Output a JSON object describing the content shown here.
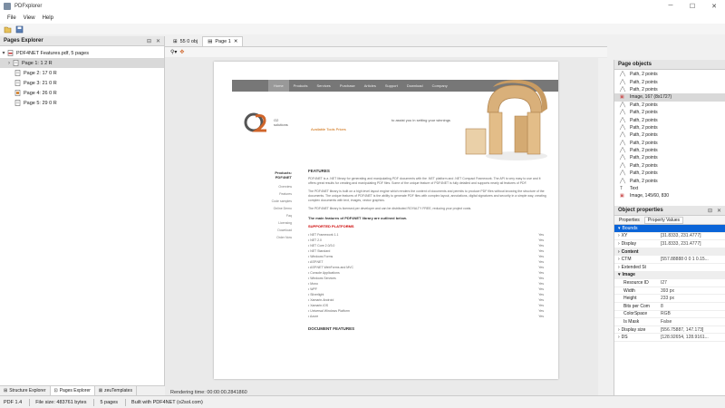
{
  "window": {
    "title": "PDFxplorer"
  },
  "menu": [
    "File",
    "View",
    "Help"
  ],
  "left_pane": {
    "header": "Pages Explorer",
    "tree": [
      {
        "label": "PDF4NET Features.pdf, 5 pages",
        "level": 0,
        "expanded": true,
        "icon": "pdf-file-icon"
      },
      {
        "label": "Page 1: 1 2 R",
        "level": 1,
        "selected": true,
        "icon": "page-icon"
      },
      {
        "label": "Page 2: 17 0 R",
        "level": 1,
        "icon": "page-icon"
      },
      {
        "label": "Page 3: 21 0 R",
        "level": 1,
        "icon": "page-icon"
      },
      {
        "label": "Page 4: 26 0 R",
        "level": 1,
        "icon": "page-icon"
      },
      {
        "label": "Page 5: 29 0 R",
        "level": 1,
        "icon": "page-icon"
      }
    ],
    "bottom_tabs": [
      "Structure Explorer",
      "Pages Explorer",
      "zeuTemplates"
    ]
  },
  "doc_tabs": [
    {
      "label": "55 0 obj",
      "active": false
    },
    {
      "label": "Page 1",
      "active": true
    }
  ],
  "render_info": "Rendering time: 00:00:00.2841860",
  "page": {
    "nav": [
      "Home",
      "Products",
      "Services",
      "Purchase",
      "Articles",
      "Support",
      "Download",
      "Company"
    ],
    "nav_active": 0,
    "logo_text": [
      "O2",
      "solutions"
    ],
    "slogan": "to assist you in setting your winnings",
    "sublink": "Available Tools Prices",
    "side_heading": [
      "Products:",
      "PDF4NET"
    ],
    "side_nav": [
      "Overview",
      "Features",
      "Code samples",
      "Online Demo",
      "Faq",
      "Licensing",
      "Download",
      "Order Now"
    ],
    "features_head": "FEATURES",
    "paragraphs": [
      "PDF4NET is a .NET library for generating and manipulating PDF documents with the .NET platform and .NET Compact Framework. The API is very easy to use and it offers great results for creating and manipulating PDF files. Some of the unique feature of PDF4NET is fully detailed and supports nearly all features of PDF.",
      "The PDF4NET library is built on a high level layout engine which renders the content of documents and permits to produce PDF files without knowing the structure of the documents. The unique features of PDF4NET is the ability to generate PDF files with complex layout, annotations, digital signatures and security in a simple way, creating complex documents with text, images, vector graphics.",
      "The PDF4NET library is licensed per developer and can be distributed ROYALTY FREE, reducing your project costs."
    ],
    "main_features_lead": "The main features of PDF4NET library are outlined below.",
    "supported_platforms_head": "SUPPORTED PLATFORMS",
    "platforms": [
      {
        "name": "• NET Framework 1.1",
        "value": "Yes"
      },
      {
        "name": "• NET 2.0",
        "value": "Yes"
      },
      {
        "name": "• NET Core 2.0/3.0",
        "value": "Yes"
      },
      {
        "name": "• NET Standard",
        "value": "Yes"
      },
      {
        "name": "• Windows Forms",
        "value": "Yes"
      },
      {
        "name": "• ASP.NET",
        "value": "Yes"
      },
      {
        "name": "• ASP.NET WebForms and MVC",
        "value": "Yes"
      },
      {
        "name": "• Console Applications",
        "value": "Yes"
      },
      {
        "name": "• Windows Services",
        "value": "Yes"
      },
      {
        "name": "• Mono",
        "value": "Yes"
      },
      {
        "name": "• WPF",
        "value": "Yes"
      },
      {
        "name": "• Silverlight",
        "value": "Yes"
      },
      {
        "name": "• Xamarin.Android",
        "value": "Yes"
      },
      {
        "name": "• Xamarin.iOS",
        "value": "Yes"
      },
      {
        "name": "• Universal Windows Platform",
        "value": "Yes"
      },
      {
        "name": "• Azure",
        "value": "Yes"
      }
    ],
    "document_features_head": "DOCUMENT FEATURES"
  },
  "right_pane": {
    "objects_header": "Page objects",
    "objects": [
      {
        "label": "Path, 2 points",
        "icon": "path-icon"
      },
      {
        "label": "Path, 2 points",
        "icon": "path-icon"
      },
      {
        "label": "Path, 2 points",
        "icon": "path-icon"
      },
      {
        "label": "Image, 167 (8x1727)",
        "icon": "image-icon",
        "selected": true
      },
      {
        "label": "Path, 2 points",
        "icon": "path-icon"
      },
      {
        "label": "Path, 2 points",
        "icon": "path-icon"
      },
      {
        "label": "Path, 2 points",
        "icon": "path-icon"
      },
      {
        "label": "Path, 2 points",
        "icon": "path-icon"
      },
      {
        "label": "Path, 2 points",
        "icon": "path-icon"
      },
      {
        "label": "Path, 2 points",
        "icon": "path-icon"
      },
      {
        "label": "Path, 2 points",
        "icon": "path-icon"
      },
      {
        "label": "Path, 2 points",
        "icon": "path-icon"
      },
      {
        "label": "Path, 2 points",
        "icon": "path-icon"
      },
      {
        "label": "Path, 2 points",
        "icon": "path-icon"
      },
      {
        "label": "Path, 2 points",
        "icon": "path-icon"
      },
      {
        "label": "Text",
        "icon": "text-icon"
      },
      {
        "label": "Image, 145/60, 830",
        "icon": "image-icon"
      }
    ],
    "props_header": "Object properties",
    "props_tabs": [
      "Properties",
      "Property Values"
    ],
    "props": [
      {
        "key": "Bounds",
        "value": "",
        "type": "sel",
        "toggle": "▾"
      },
      {
        "key": "XY",
        "value": "[31.8333, 231.4777]",
        "type": "item",
        "toggle": "›"
      },
      {
        "key": "Display",
        "value": "[31.8333, 231.4777]",
        "type": "item",
        "toggle": "›"
      },
      {
        "key": "Content",
        "value": "",
        "type": "group",
        "toggle": "›"
      },
      {
        "key": "CTM",
        "value": "[557.88888 0 0 1 0.15...",
        "type": "item",
        "toggle": "›"
      },
      {
        "key": "Extended St",
        "value": "",
        "type": "item",
        "toggle": "›"
      },
      {
        "key": "Image",
        "value": "",
        "type": "group",
        "toggle": "▾"
      },
      {
        "key": "Resource ID",
        "value": "I27",
        "type": "item",
        "toggle": ""
      },
      {
        "key": "Width",
        "value": "393 px",
        "type": "item",
        "toggle": ""
      },
      {
        "key": "Height",
        "value": "233 px",
        "type": "item",
        "toggle": ""
      },
      {
        "key": "Bits per Com",
        "value": "8",
        "type": "item",
        "toggle": ""
      },
      {
        "key": "ColorSpace",
        "value": "RGB",
        "type": "item",
        "toggle": ""
      },
      {
        "key": "Is Mask",
        "value": "False",
        "type": "item",
        "toggle": ""
      },
      {
        "key": "Display size",
        "value": "[556.75887, 147.173]",
        "type": "item",
        "toggle": "›"
      },
      {
        "key": "DS",
        "value": "[128.92654, 128.9161...",
        "type": "item",
        "toggle": "›"
      }
    ]
  },
  "status": {
    "pdf_version": "PDF 1.4",
    "file_size": "File size: 483761 bytes",
    "pages": "5 pages",
    "built_with": "Built with PDF4NET (o2sol.com)"
  }
}
